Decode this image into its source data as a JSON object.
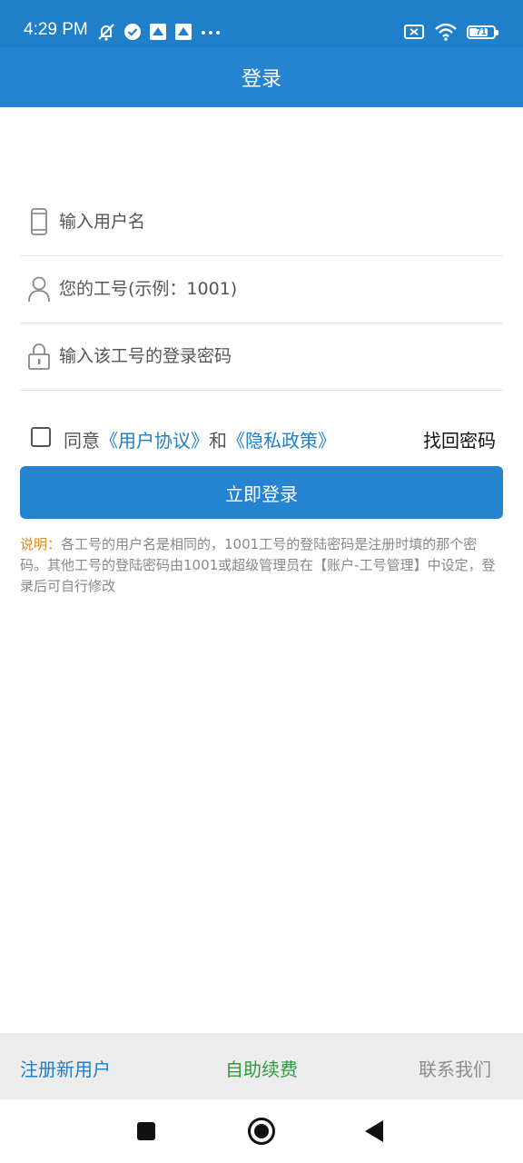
{
  "status_bar": {
    "time": "4:29 PM",
    "battery_level": "71",
    "icons": [
      "mute-icon",
      "check-circle-icon",
      "app-notification-icon",
      "app-notification-icon",
      "more-icon",
      "no-sim-icon",
      "wifi-icon",
      "battery-icon"
    ]
  },
  "app_bar": {
    "title": "登录"
  },
  "form": {
    "username": {
      "placeholder": "输入用户名",
      "value": "",
      "icon": "phone-icon"
    },
    "employee_id": {
      "placeholder": "您的工号(示例：1001)",
      "value": "",
      "icon": "person-icon"
    },
    "password": {
      "placeholder": "输入该工号的登录密码",
      "value": "",
      "icon": "lock-icon"
    },
    "agree": {
      "checked": false,
      "prefix": "同意",
      "user_agreement": "《用户协议》",
      "and": "和",
      "privacy_policy": "《隐私政策》"
    },
    "forgot_password": "找回密码",
    "login_button": "立即登录"
  },
  "note": {
    "label": "说明：",
    "text": "各工号的用户名是相同的，1001工号的登陆密码是注册时填的那个密码。其他工号的登陆密码由1001或超级管理员在【账户-工号管理】中设定，登录后可自行修改"
  },
  "bottom_bar": {
    "register": "注册新用户",
    "renew": "自助续费",
    "contact": "联系我们"
  },
  "colors": {
    "primary": "#2484d2",
    "status_bar": "#1f7fc9",
    "note_label": "#d98a1e",
    "renew": "#2e9a3f",
    "contact": "#8c8c8c"
  }
}
